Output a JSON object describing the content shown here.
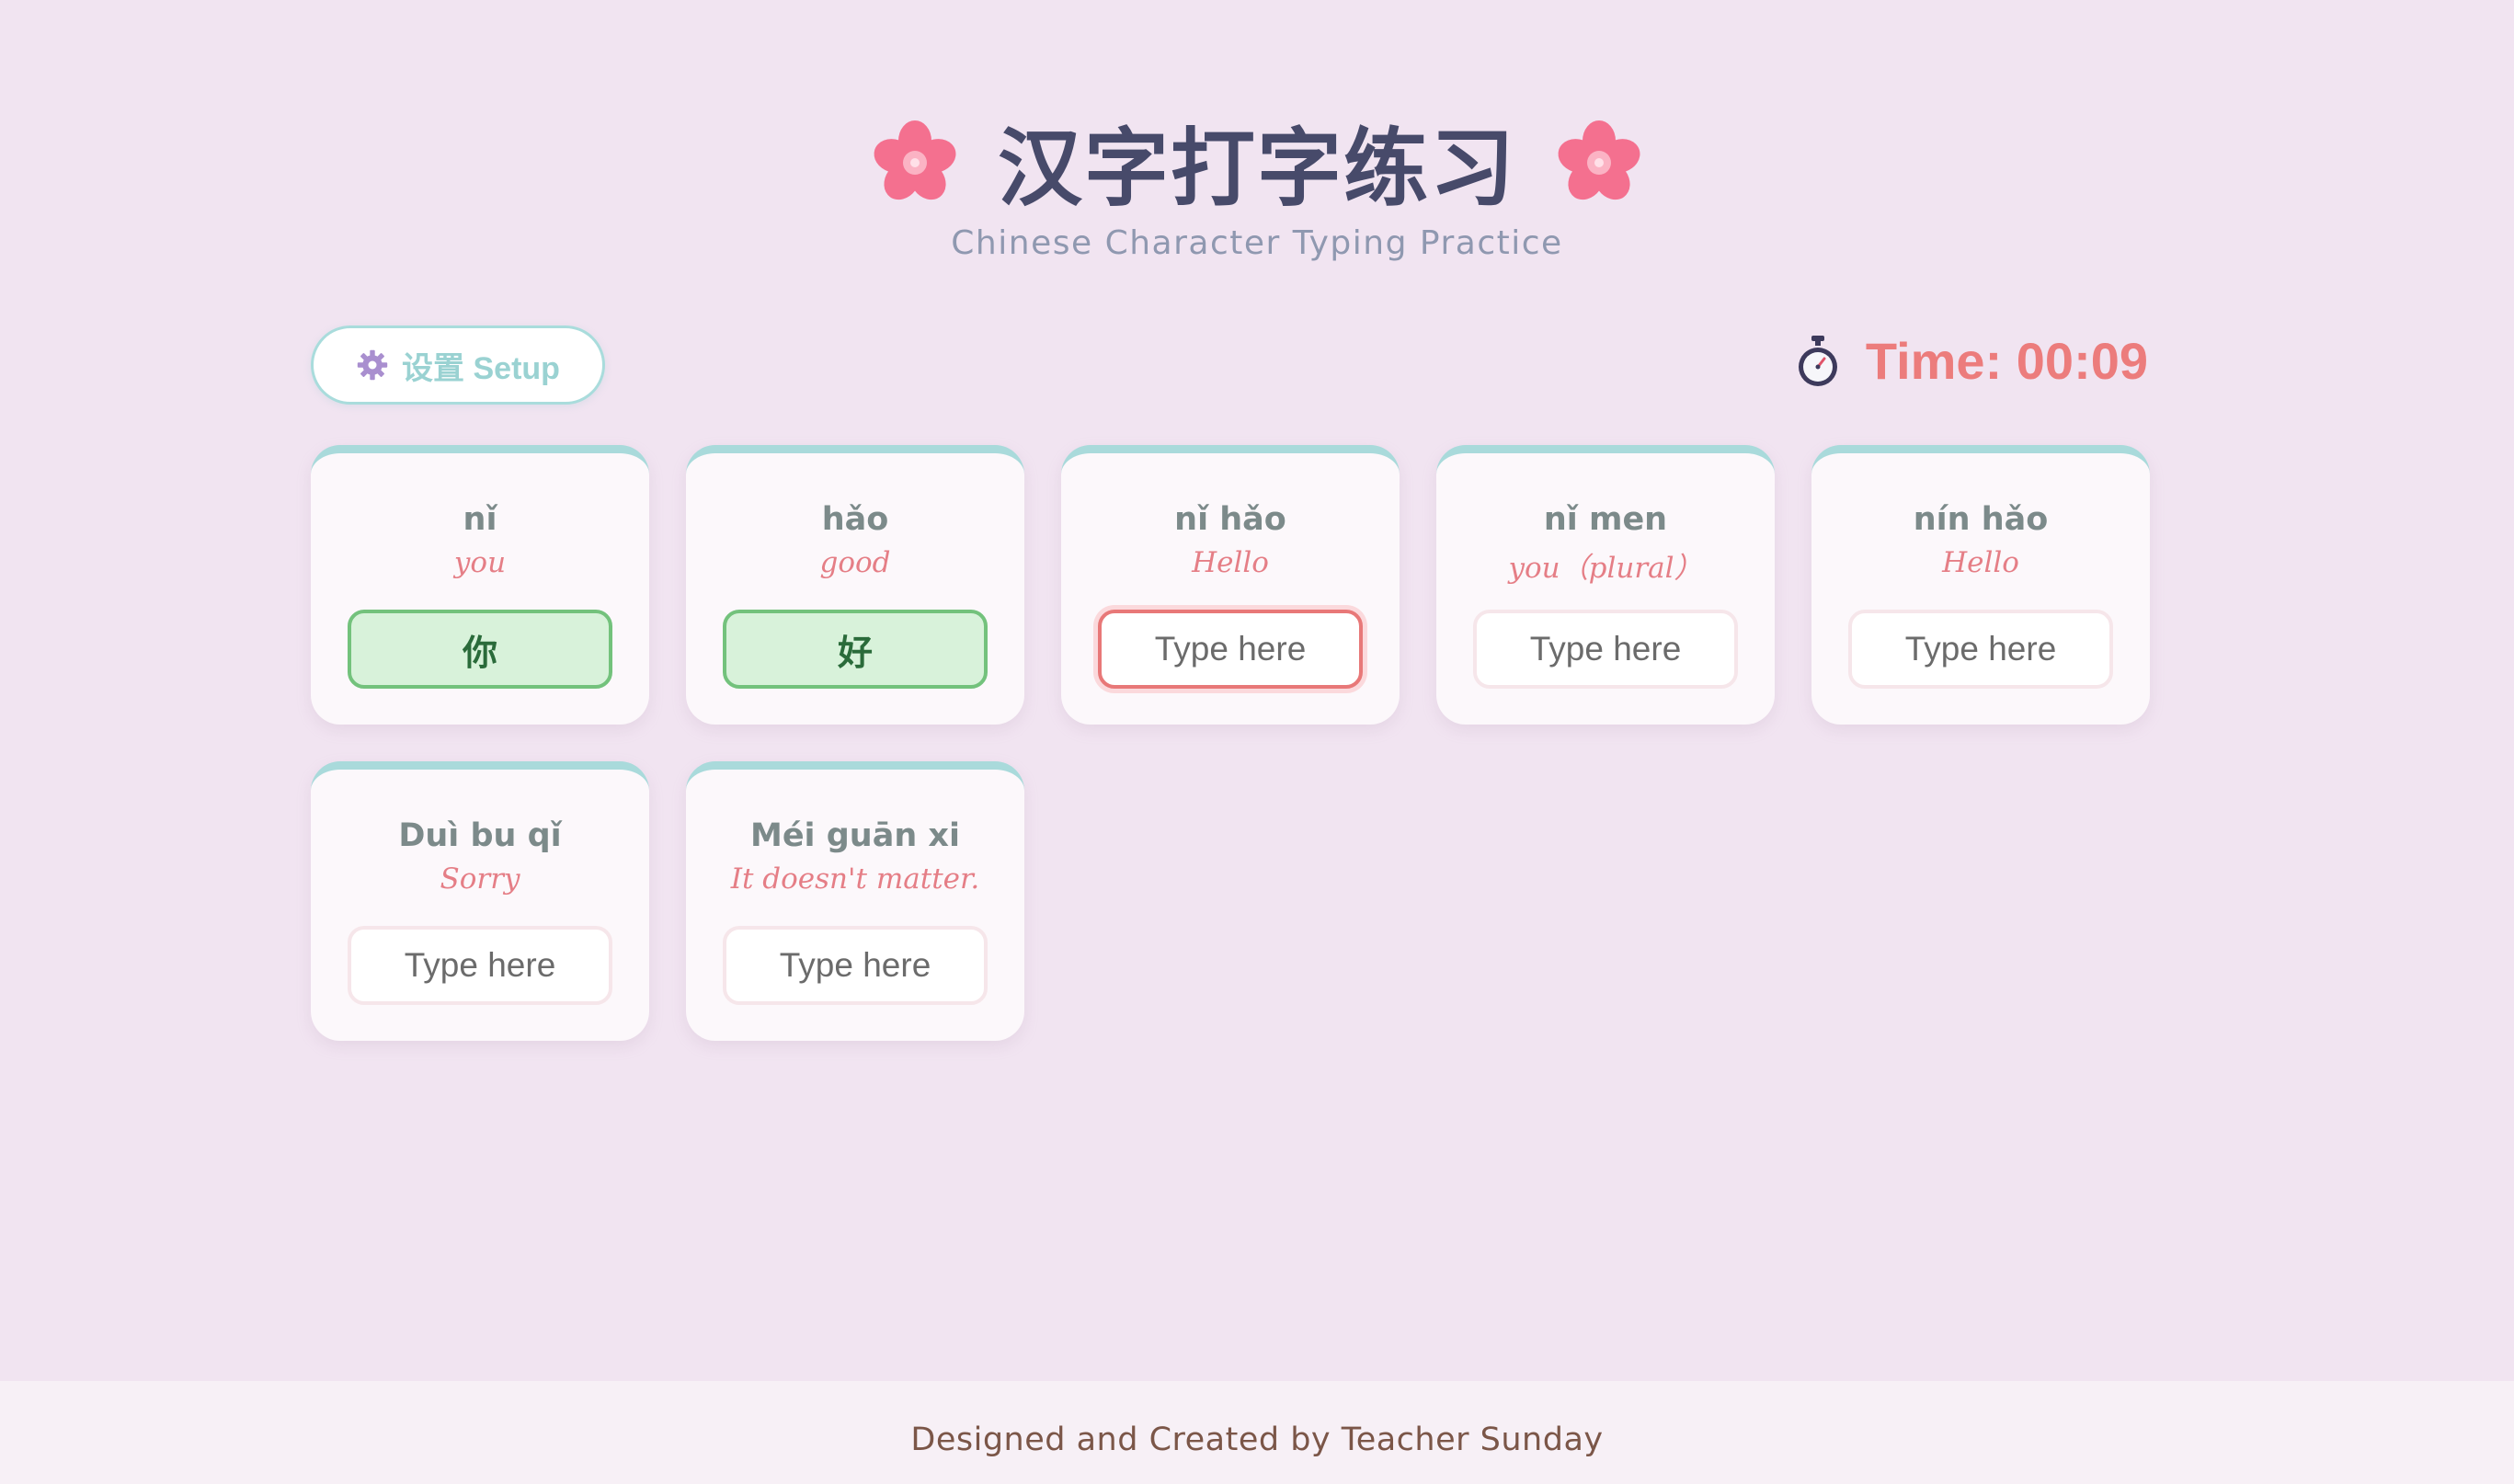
{
  "header": {
    "title": "汉字打字练习",
    "subtitle": "Chinese Character Typing Practice",
    "decoration_icon": "cherry-blossom-icon"
  },
  "toolbar": {
    "setup_label": "设置 Setup",
    "setup_icon": "gear-icon"
  },
  "timer": {
    "icon": "stopwatch-icon",
    "label": "Time: 00:09"
  },
  "cards": [
    {
      "pinyin": "nǐ",
      "meaning": "you",
      "value": "你",
      "placeholder": "Type here",
      "status": "correct"
    },
    {
      "pinyin": "hǎo",
      "meaning": "good",
      "value": "好",
      "placeholder": "Type here",
      "status": "correct"
    },
    {
      "pinyin": "nǐ hǎo",
      "meaning": "Hello",
      "value": "",
      "placeholder": "Type here",
      "status": "focused"
    },
    {
      "pinyin": "nǐ men",
      "meaning": "you（plural）",
      "value": "",
      "placeholder": "Type here",
      "status": "empty"
    },
    {
      "pinyin": "nín hǎo",
      "meaning": "Hello",
      "value": "",
      "placeholder": "Type here",
      "status": "empty"
    },
    {
      "pinyin": "Duì bu qǐ",
      "meaning": "Sorry",
      "value": "",
      "placeholder": "Type here",
      "status": "empty"
    },
    {
      "pinyin": "Méi guān xi",
      "meaning": "It doesn't matter.",
      "value": "",
      "placeholder": "Type here",
      "status": "empty"
    }
  ],
  "footer": {
    "credit": "Designed and Created by Teacher Sunday"
  },
  "colors": {
    "background": "#f1e4f1",
    "accent_teal": "#a9dadb",
    "accent_coral": "#ec7c7c",
    "correct_green": "#d8f2da",
    "title_navy": "#474a6a"
  }
}
